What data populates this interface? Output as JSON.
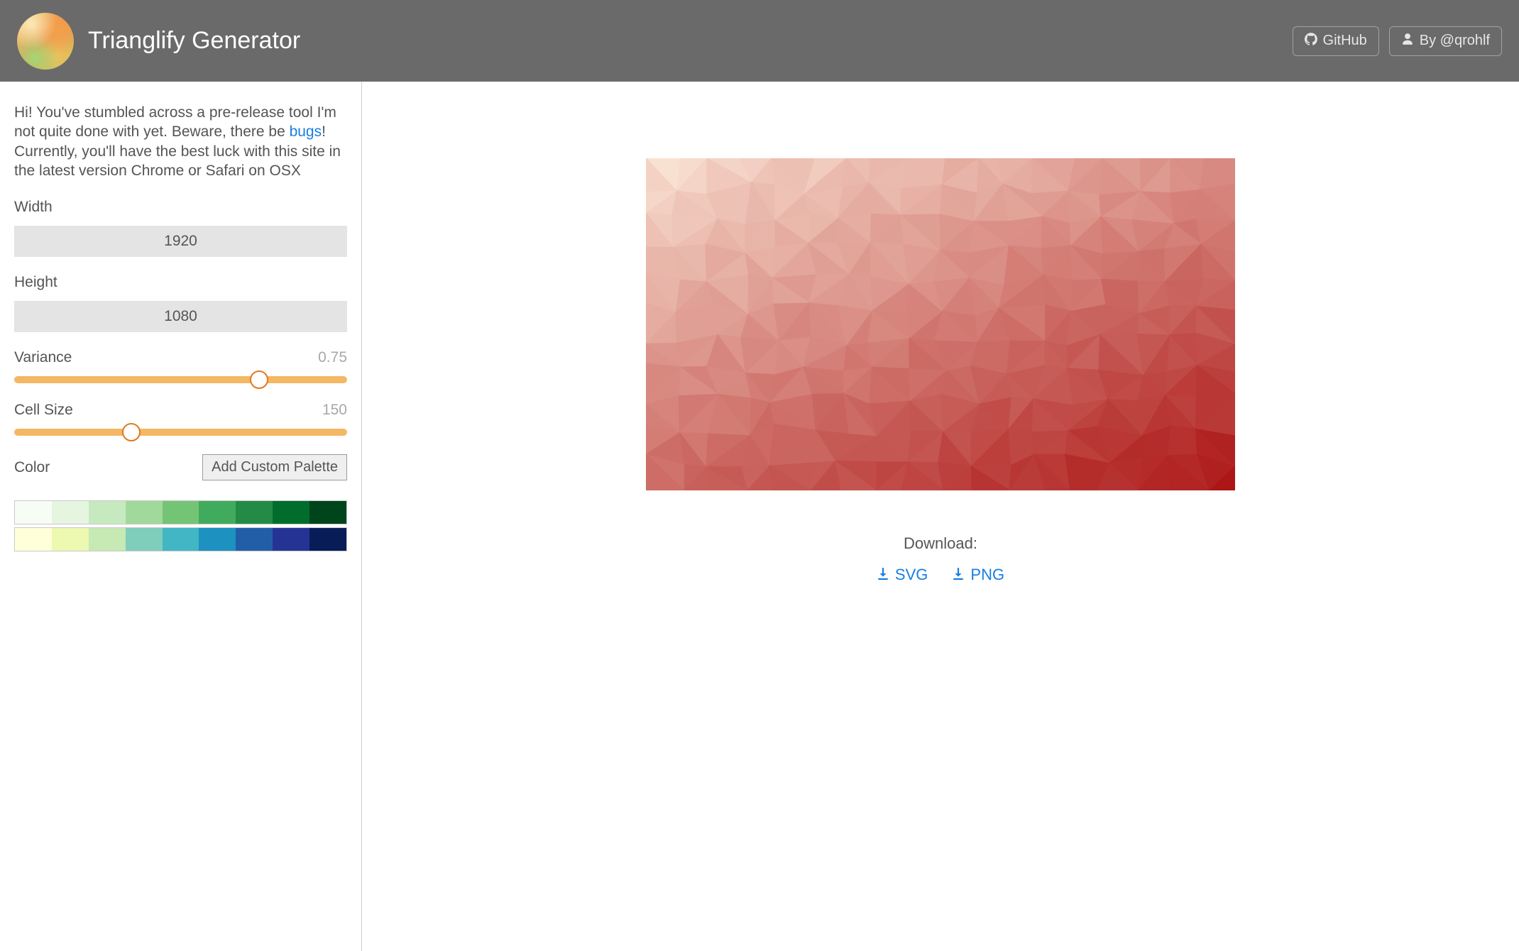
{
  "header": {
    "title": "Trianglify Generator",
    "github_label": "GitHub",
    "author_label": "By @qrohlf"
  },
  "intro": {
    "line1": "Hi! You've stumbled across a pre-release tool I'm not quite done with yet. Beware, there be ",
    "bugs_link": "bugs",
    "after_bugs": "! Currently, you'll have the best luck with this site in the latest version Chrome or Safari on OSX"
  },
  "fields": {
    "width_label": "Width",
    "width_value": "1920",
    "height_label": "Height",
    "height_value": "1080",
    "variance_label": "Variance",
    "variance_value": "0.75",
    "cellsize_label": "Cell Size",
    "cellsize_value": "150",
    "color_label": "Color",
    "add_palette_label": "Add Custom Palette"
  },
  "palettes": [
    [
      "#f7fcf5",
      "#e5f5e0",
      "#c7e9c0",
      "#a1d99b",
      "#74c476",
      "#41ab5d",
      "#238b45",
      "#006d2c",
      "#00441b"
    ],
    [
      "#ffffd9",
      "#edf8b1",
      "#c7e9b4",
      "#7fcdbb",
      "#41b6c4",
      "#1d91c0",
      "#225ea8",
      "#253494",
      "#081d58"
    ]
  ],
  "download": {
    "label": "Download:",
    "svg_label": "SVG",
    "png_label": "PNG"
  }
}
